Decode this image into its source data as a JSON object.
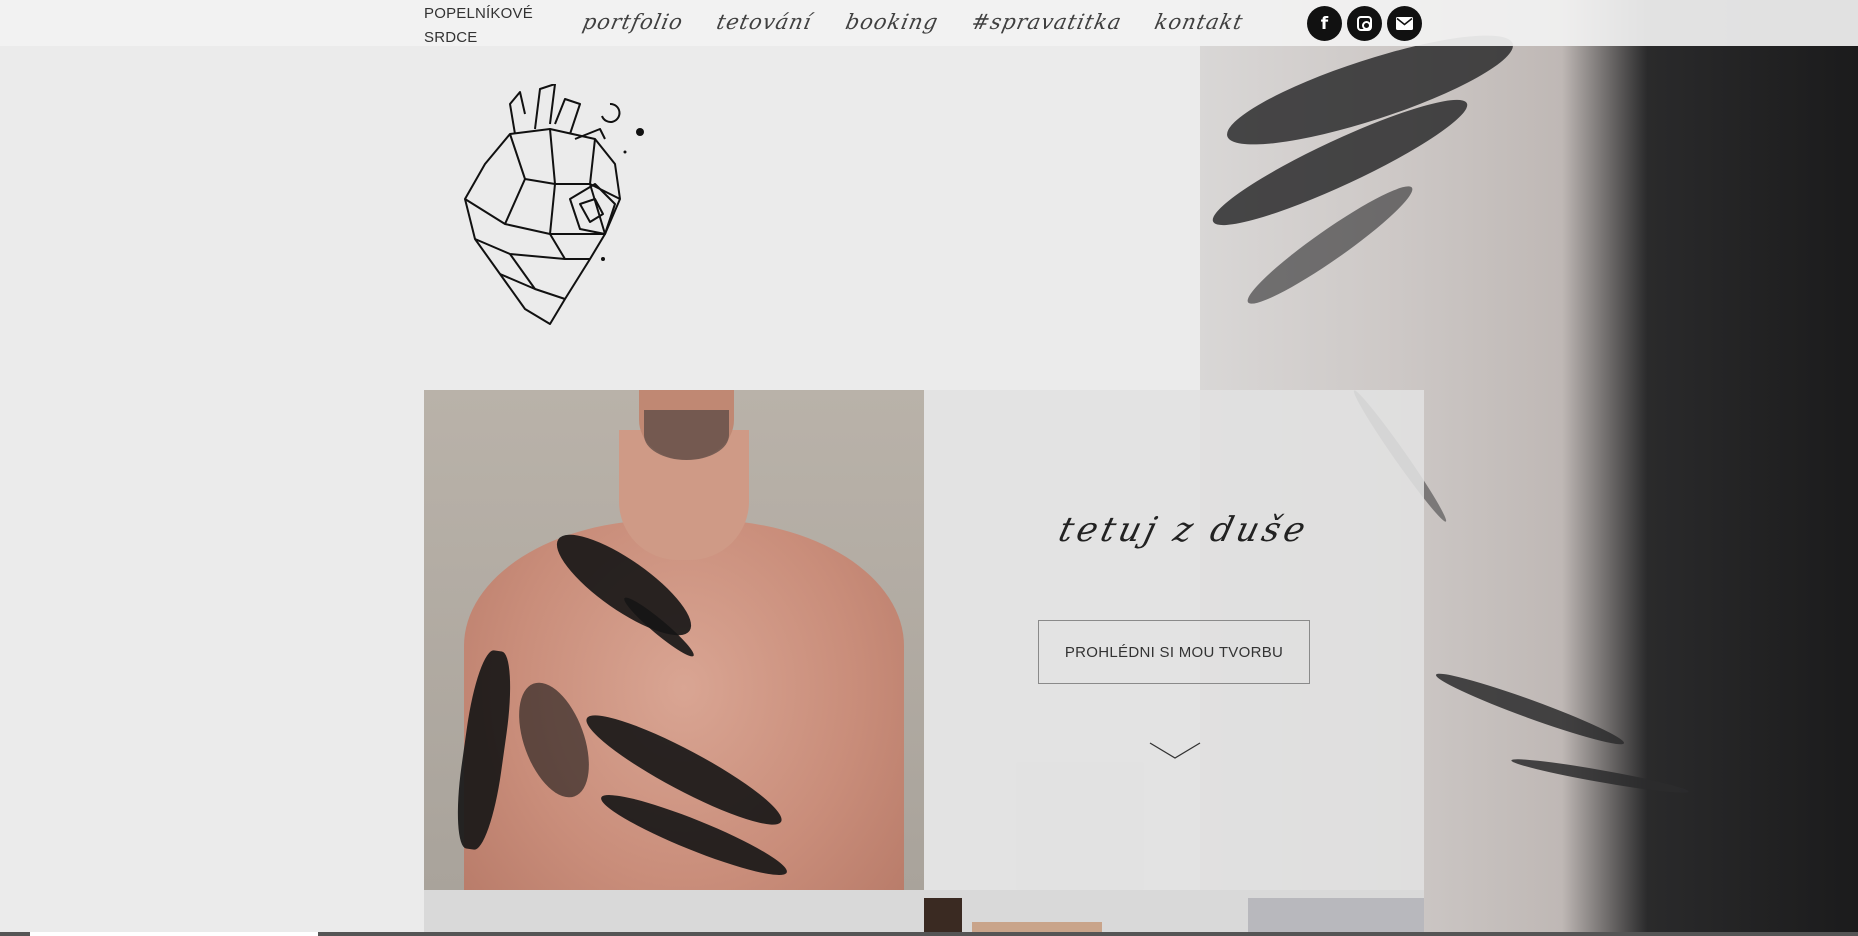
{
  "brand": {
    "line1": "POPELNÍKOVÉ",
    "line2": "SRDCE"
  },
  "nav": {
    "items": [
      {
        "label": "portfolio"
      },
      {
        "label": "tetování"
      },
      {
        "label": "booking"
      },
      {
        "label": "#spravatitka"
      },
      {
        "label": "kontakt"
      }
    ]
  },
  "social": {
    "icons": [
      {
        "name": "facebook-icon",
        "glyph": "f"
      },
      {
        "name": "instagram-icon"
      },
      {
        "name": "email-icon"
      }
    ]
  },
  "hero": {
    "tagline": "tetuj z duše",
    "cta_label": "PROHLÉDNI SI MOU TVORBU"
  },
  "colors": {
    "background": "#ebebeb",
    "topbar": "#f2f2f2",
    "text": "#333333",
    "icon_bg": "#111111"
  }
}
